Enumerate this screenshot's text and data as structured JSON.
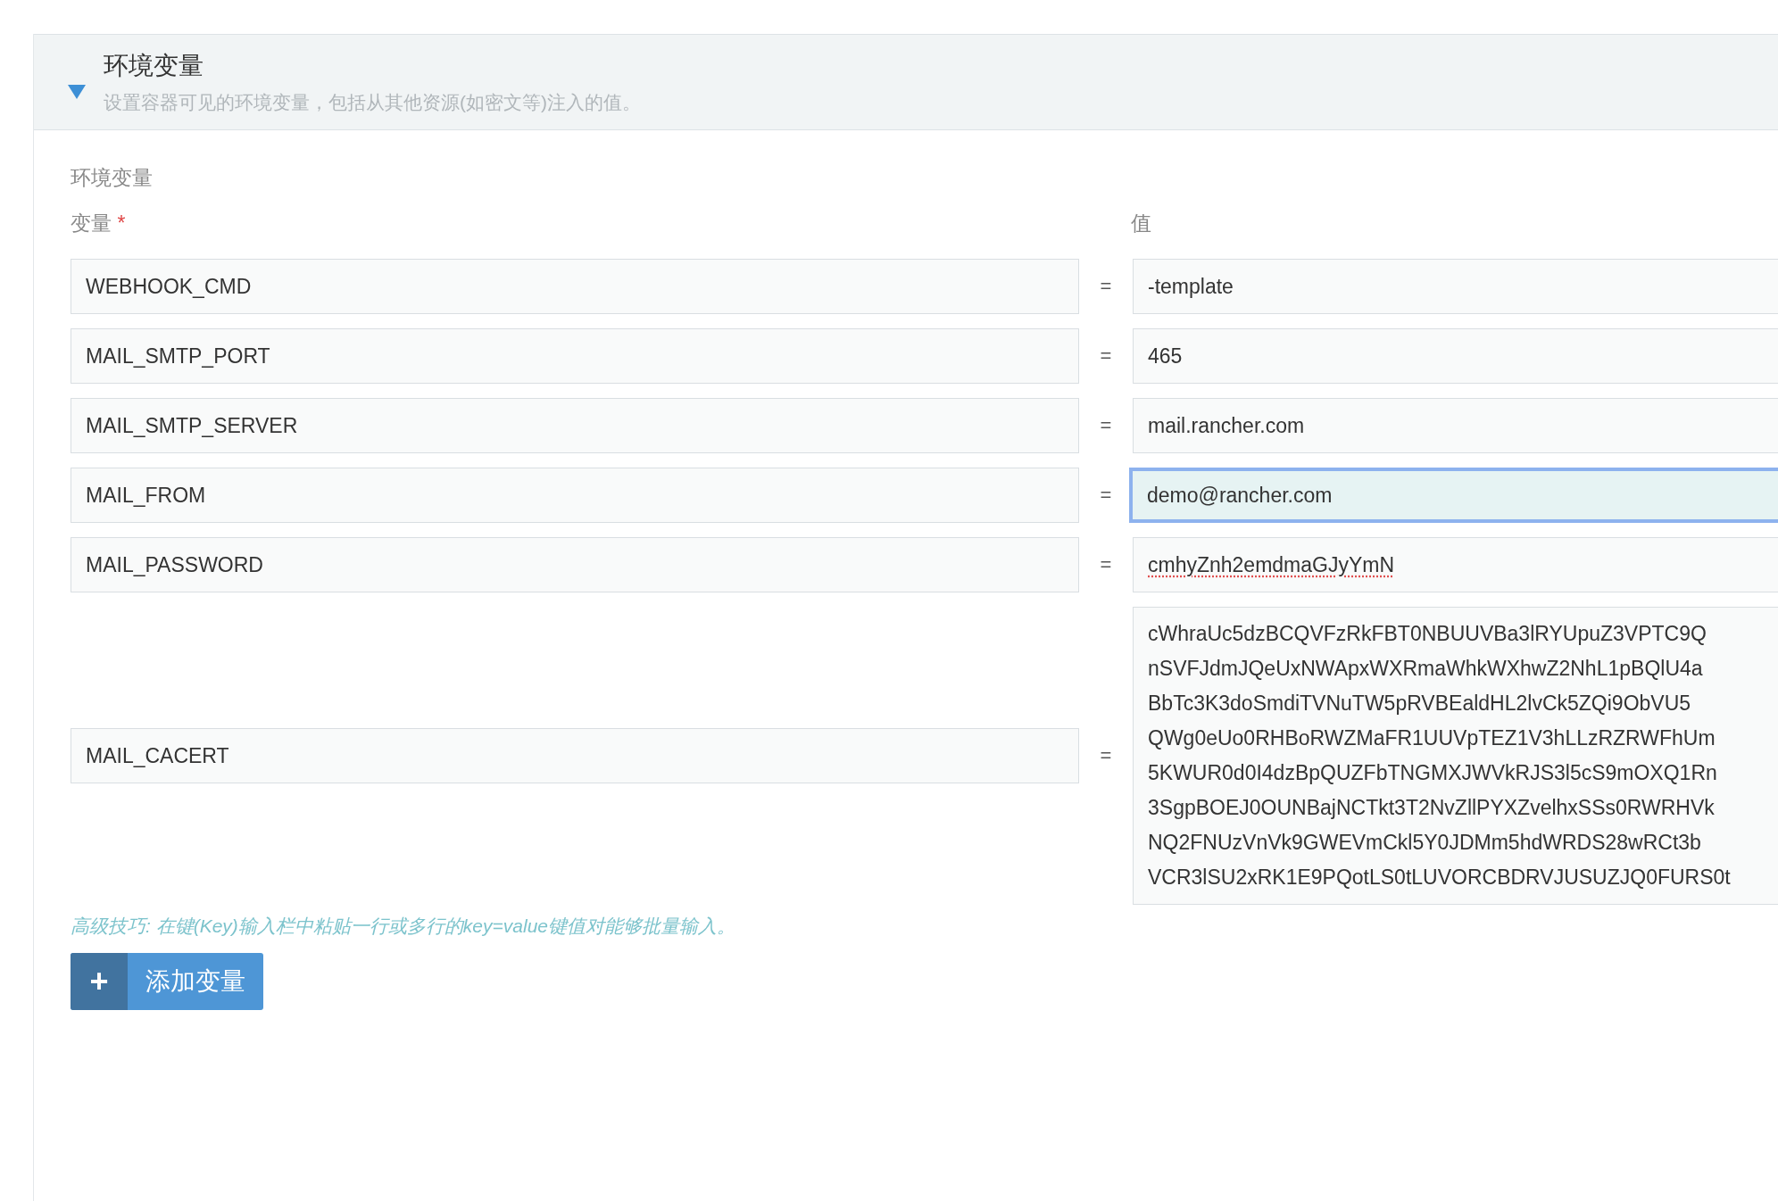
{
  "section": {
    "title": "环境变量",
    "description": "设置容器可见的环境变量，包括从其他资源(如密文等)注入的值。",
    "expanded": true
  },
  "group_label": "环境变量",
  "columns": {
    "key": "变量",
    "required_mark": "*",
    "value": "值"
  },
  "rows": [
    {
      "key": "WEBHOOK_CMD",
      "separator": "=",
      "value": [
        "-template"
      ],
      "focused": false,
      "misspelled": false
    },
    {
      "key": "MAIL_SMTP_PORT",
      "separator": "=",
      "value": [
        "465"
      ],
      "focused": false,
      "misspelled": false
    },
    {
      "key": "MAIL_SMTP_SERVER",
      "separator": "=",
      "value": [
        "mail.rancher.com"
      ],
      "focused": false,
      "misspelled": false
    },
    {
      "key": "MAIL_FROM",
      "separator": "=",
      "value": [
        "demo@rancher.com"
      ],
      "focused": true,
      "misspelled": false
    },
    {
      "key": "MAIL_PASSWORD",
      "separator": "=",
      "value": [
        "cmhyZnh2emdmaGJyYmN"
      ],
      "focused": false,
      "misspelled": true
    },
    {
      "key": "MAIL_CACERT",
      "separator": "=",
      "value": [
        "cWhraUc5dzBCQVFzRkFBT0NBUUVBa3lRYUpuZ3VPTC9Q",
        "nSVFJdmJQeUxNWApxWXRmaWhkWXhwZ2NhL1pBQlU4a",
        "BbTc3K3doSmdiTVNuTW5pRVBEaldHL2lvCk5ZQi9ObVU5",
        "QWg0eUo0RHBoRWZMaFR1UUVpTEZ1V3hLLzRZRWFhUm",
        "5KWUR0d0I4dzBpQUZFbTNGMXJWVkRJS3l5cS9mOXQ1Rn",
        "3SgpBOEJ0OUNBajNCTkt3T2NvZllPYXZvelhxSSs0RWRHVk",
        "NQ2FNUzVnVk9GWEVmCkl5Y0JDMm5hdWRDS28wRCt3b",
        "VCR3lSU2xRK1E9PQotLS0tLUVORCBDRVJUSUZJQ0FURS0t"
      ],
      "focused": false,
      "misspelled": false
    }
  ],
  "tip": "高级技巧: 在键(Key)输入栏中粘贴一行或多行的key=value键值对能够批量输入。",
  "add_button": {
    "icon": "+",
    "label": "添加变量"
  }
}
